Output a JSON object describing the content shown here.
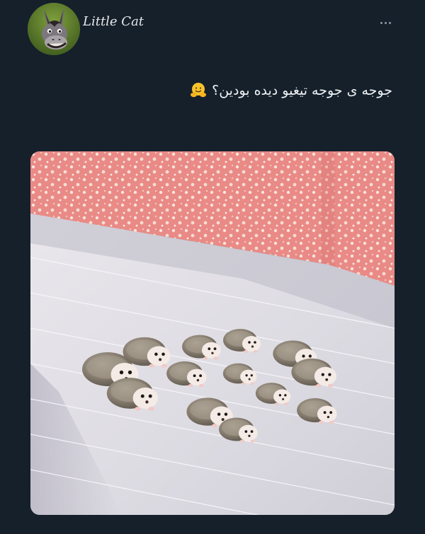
{
  "post": {
    "author_name": "Little Cat",
    "text": "جوجه ی جوجه تیغیو دیده بودین؟",
    "emoji": "hugging-face-icon",
    "more_menu": "more-options-icon"
  },
  "colors": {
    "background": "#15202b",
    "text": "#e7e9ea",
    "muted": "#8b98a5"
  },
  "media": {
    "subject": "photo-hedgehogs-icon"
  }
}
